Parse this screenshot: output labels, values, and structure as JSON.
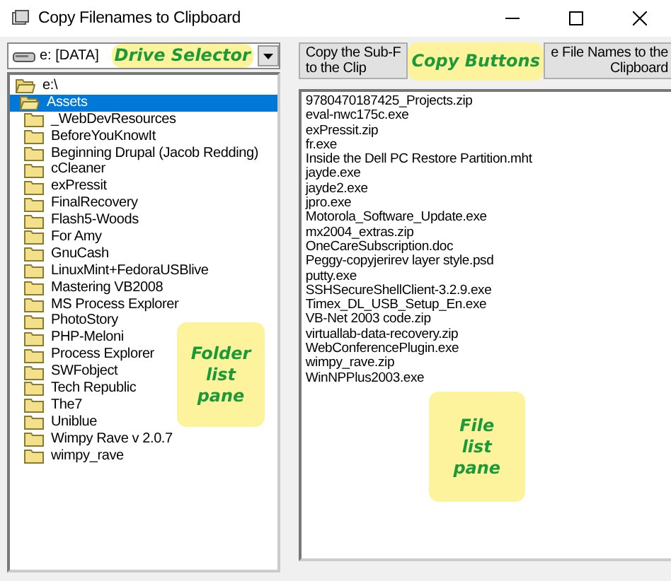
{
  "window": {
    "title": "Copy Filenames to Clipboard"
  },
  "drive_selector": {
    "value": "e: [DATA]",
    "callout": "Drive Selector"
  },
  "copy_buttons": {
    "callout": "Copy Buttons",
    "buttons": [
      "Copy the Sub-F\nto the Clip",
      "e File Names to the\nClipboard"
    ]
  },
  "folder_tree": {
    "callout": "Folder\nlist\npane",
    "items": [
      {
        "label": "e:\\",
        "selected": false,
        "children": [
          {
            "label": "Assets",
            "selected": true,
            "children": [
              {
                "label": "_WebDevResources",
                "selected": false
              },
              {
                "label": "BeforeYouKnowIt",
                "selected": false
              },
              {
                "label": "Beginning Drupal (Jacob Redding)",
                "selected": false
              },
              {
                "label": "cCleaner",
                "selected": false
              },
              {
                "label": "exPressit",
                "selected": false
              },
              {
                "label": "FinalRecovery",
                "selected": false
              },
              {
                "label": "Flash5-Woods",
                "selected": false
              },
              {
                "label": "For Amy",
                "selected": false
              },
              {
                "label": "GnuCash",
                "selected": false
              },
              {
                "label": "LinuxMint+FedoraUSBlive",
                "selected": false
              },
              {
                "label": "Mastering VB2008",
                "selected": false
              },
              {
                "label": "MS Process Explorer",
                "selected": false
              },
              {
                "label": "PhotoStory",
                "selected": false
              },
              {
                "label": "PHP-Meloni",
                "selected": false
              },
              {
                "label": "Process Explorer",
                "selected": false
              },
              {
                "label": "SWFobject",
                "selected": false
              },
              {
                "label": "Tech Republic",
                "selected": false
              },
              {
                "label": "The7",
                "selected": false
              },
              {
                "label": "Uniblue",
                "selected": false
              },
              {
                "label": "Wimpy Rave v 2.0.7",
                "selected": false
              },
              {
                "label": "wimpy_rave",
                "selected": false
              }
            ]
          }
        ]
      }
    ]
  },
  "file_list": {
    "callout": "File\nlist\npane",
    "files": [
      "9780470187425_Projects.zip",
      "eval-nwc175c.exe",
      "exPressit.zip",
      "fr.exe",
      "Inside the Dell PC Restore Partition.mht",
      "jayde.exe",
      "jayde2.exe",
      "jpro.exe",
      "Motorola_Software_Update.exe",
      "mx2004_extras.zip",
      "OneCareSubscription.doc",
      "Peggy-copyjerirev layer style.psd",
      "putty.exe",
      "SSHSecureShellClient-3.2.9.exe",
      "Timex_DL_USB_Setup_En.exe",
      "VB-Net 2003 code.zip",
      "virtuallab-data-recovery.zip",
      "WebConferencePlugin.exe",
      "wimpy_rave.zip",
      "WinNPPlus2003.exe"
    ]
  }
}
